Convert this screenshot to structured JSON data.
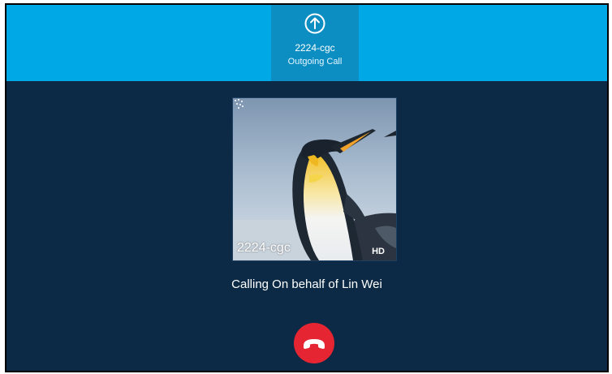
{
  "header": {
    "contact": "2224-cgc",
    "call_type": "Outgoing Call",
    "icon": "outgoing-call-arrow-icon"
  },
  "contact_card": {
    "name": "2224-cgc",
    "hd_label": "HD",
    "photo": "penguin-photo"
  },
  "status_text": "Calling On behalf of Lin Wei",
  "actions": {
    "end_call_icon": "hang-up-icon"
  },
  "colors": {
    "header_bg": "#00a9e6",
    "active_tab_bg": "#0c8ec2",
    "screen_bg": "#0c2a45",
    "end_call": "#e62532"
  }
}
